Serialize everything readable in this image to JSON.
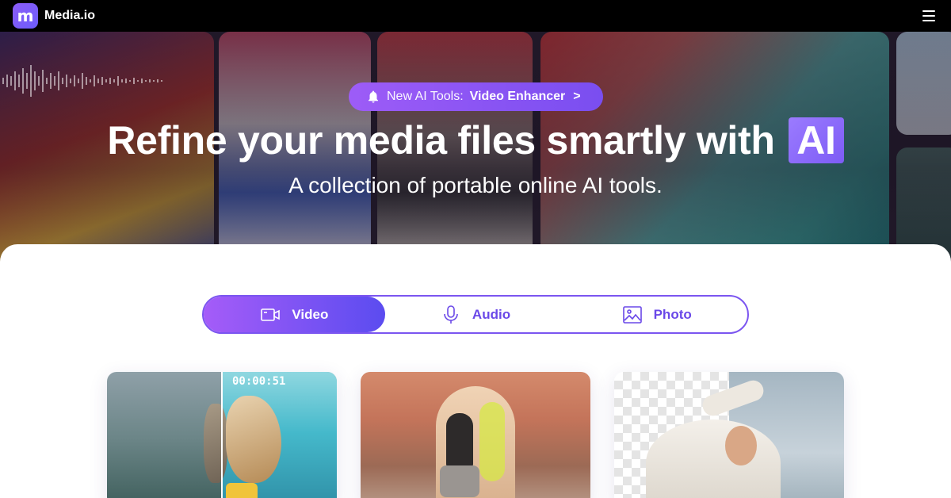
{
  "header": {
    "logo_mark": "m",
    "brand": "Media.io"
  },
  "hero": {
    "badge": {
      "prefix": "New AI Tools:",
      "tool": "Video Enhancer",
      "arrow": ">"
    },
    "title": "Refine your media files smartly with",
    "title_highlight": "AI",
    "subtitle": "A collection of portable online AI tools."
  },
  "tabs": [
    {
      "label": "Video",
      "icon": "video-camera-icon",
      "active": true
    },
    {
      "label": "Audio",
      "icon": "microphone-icon",
      "active": false
    },
    {
      "label": "Photo",
      "icon": "image-icon",
      "active": false
    }
  ],
  "cards": [
    {
      "timecode": "00:00:51"
    }
  ],
  "colors": {
    "accent": "#7b55f0",
    "accent_gradient_start": "#a55cf8",
    "accent_gradient_end": "#5b4cf0",
    "topbar": "#000000"
  }
}
